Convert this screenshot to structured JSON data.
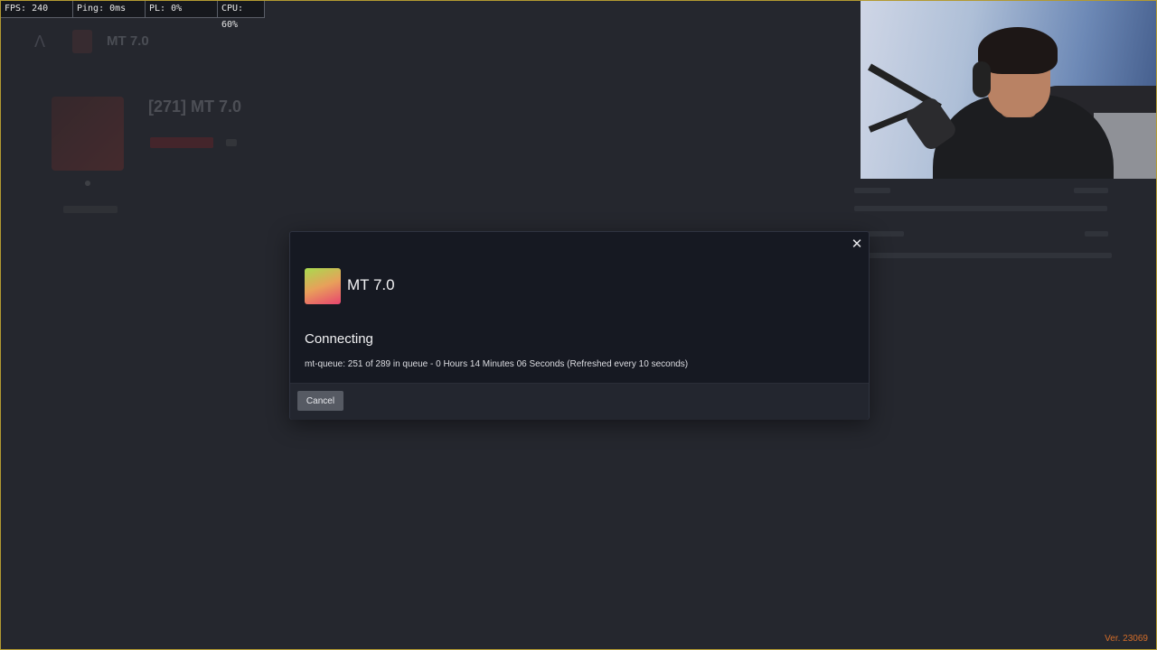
{
  "perf_overlay": {
    "fps": "FPS: 240",
    "ping": "Ping: 0ms",
    "pl": "PL: 0%",
    "cpu": "CPU: 60%"
  },
  "background_app": {
    "header_title": "MT 7.0",
    "server_title": "[271] MT 7.0"
  },
  "modal": {
    "close_icon": "close-icon",
    "logo": "server-logo",
    "title": "MT 7.0",
    "status": "Connecting",
    "queue_text": "mt-queue: 251 of 289 in queue - 0 Hours 14 Minutes 06 Seconds (Refreshed every 10 seconds)",
    "cancel_label": "Cancel"
  },
  "version": "Ver. 23069",
  "colors": {
    "accent_border": "#b39a32",
    "modal_bg": "#161922",
    "version_text": "#d36d29"
  }
}
